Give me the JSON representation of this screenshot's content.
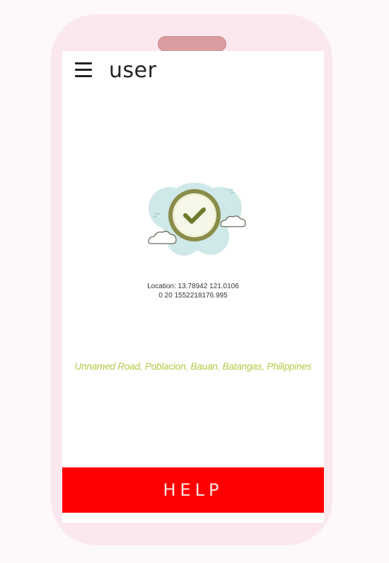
{
  "appbar": {
    "title": "user",
    "menu_icon": "hamburger-menu-icon"
  },
  "status": {
    "icon": "checkmark-circle-icon",
    "location_line1": "Location: 13.78942 121.0106",
    "location_line2": "0 20 1552218176.995"
  },
  "address": "Unnamed Road, Poblacion, Bauan, Batangas, Philippines",
  "help_button": {
    "label": "HELP"
  },
  "colors": {
    "help_button_bg": "#ff0000",
    "address_text": "#b4c845",
    "check_ring": "#8a8c4a",
    "cloud_bg": "#cfe9e8",
    "phone_frame": "#fbe8ee"
  }
}
